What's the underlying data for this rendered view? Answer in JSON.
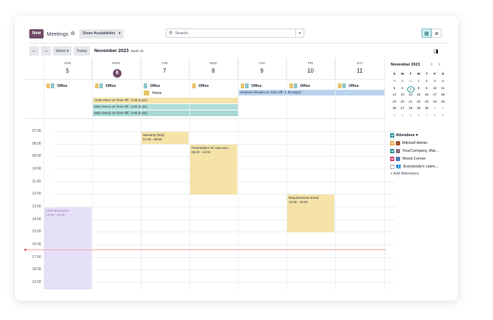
{
  "header": {
    "new_label": "New",
    "title": "Meetings",
    "share_label": "Share Availabilities",
    "search_placeholder": "Search..."
  },
  "nav": {
    "prev": "←",
    "next": "→",
    "scale_label": "Week",
    "today_label": "Today",
    "month_label": "November 2023",
    "week_label": "Week 45"
  },
  "days": [
    {
      "name": "SUN",
      "num": "5"
    },
    {
      "name": "MON",
      "num": "6"
    },
    {
      "name": "TUE",
      "num": "7"
    },
    {
      "name": "WED",
      "num": "8"
    },
    {
      "name": "THU",
      "num": "9"
    },
    {
      "name": "FRI",
      "num": "10"
    },
    {
      "name": "SAT",
      "num": "11"
    }
  ],
  "locations": {
    "office": "Office",
    "home": "Home"
  },
  "allday_events": [
    {
      "text": "Anita Oliver on Time Off : 3.00 day(s)",
      "color": "#f5e3a8"
    },
    {
      "text": "Marc Demo on Time Off : 3.00 day(s)",
      "color": "#b2dfdb"
    },
    {
      "text": "Marc Demo on Time Off : 3.00 day(s)",
      "color": "#a8d8d4"
    },
    {
      "text": "Sharlene Rhodes on Time Off : 6.00 day(s)",
      "color": "#b9d3ef"
    }
  ],
  "hours": [
    "07:00",
    "08:00",
    "09:00",
    "10:00",
    "11:00",
    "12:00",
    "13:00",
    "14:00",
    "15:00",
    "16:00",
    "17:00",
    "18:00",
    "19:00"
  ],
  "events": [
    {
      "title": "Warranty (#03)",
      "time": "07:00 - 08:00",
      "color": "#f5e3a8"
    },
    {
      "title": "Presentation for new serv...",
      "time": "08:00 - 12:00",
      "color": "#f5e3a8"
    },
    {
      "title": "Requirements review",
      "time": "12:00 - 15:00",
      "color": "#f5e3a8"
    },
    {
      "title": "Initial discussion",
      "time": "13:00 - 20:00",
      "color": "#e6dff8"
    }
  ],
  "mini_calendar": {
    "title": "November 2023",
    "weekdays": [
      "S",
      "M",
      "T",
      "W",
      "T",
      "F",
      "S"
    ],
    "weeks": [
      [
        "29",
        "30",
        "31",
        "1",
        "2",
        "3",
        "4"
      ],
      [
        "5",
        "6",
        "7",
        "8",
        "9",
        "10",
        "11"
      ],
      [
        "12",
        "13",
        "14",
        "15",
        "16",
        "17",
        "18"
      ],
      [
        "19",
        "20",
        "21",
        "22",
        "23",
        "24",
        "25"
      ],
      [
        "26",
        "27",
        "28",
        "29",
        "30",
        "1",
        "2"
      ],
      [
        "3",
        "4",
        "5",
        "6",
        "7",
        "8",
        "9"
      ]
    ],
    "selected": "7"
  },
  "attendees": {
    "title": "Attendees",
    "items": [
      {
        "name": "Mitchell Admin",
        "color": "#e9a23b"
      },
      {
        "name": "YourCompany, Mar...",
        "color": "#1f8a8f"
      },
      {
        "name": "Wood Corner",
        "color": "#d6336c"
      },
      {
        "name": "Everybody's calen...",
        "color": "#ffffff"
      }
    ],
    "add_label": "+ Add Attendees"
  },
  "colors": {
    "brand": "#714b67",
    "accent": "#1f8a8f",
    "now_line": "#e05a5a"
  }
}
